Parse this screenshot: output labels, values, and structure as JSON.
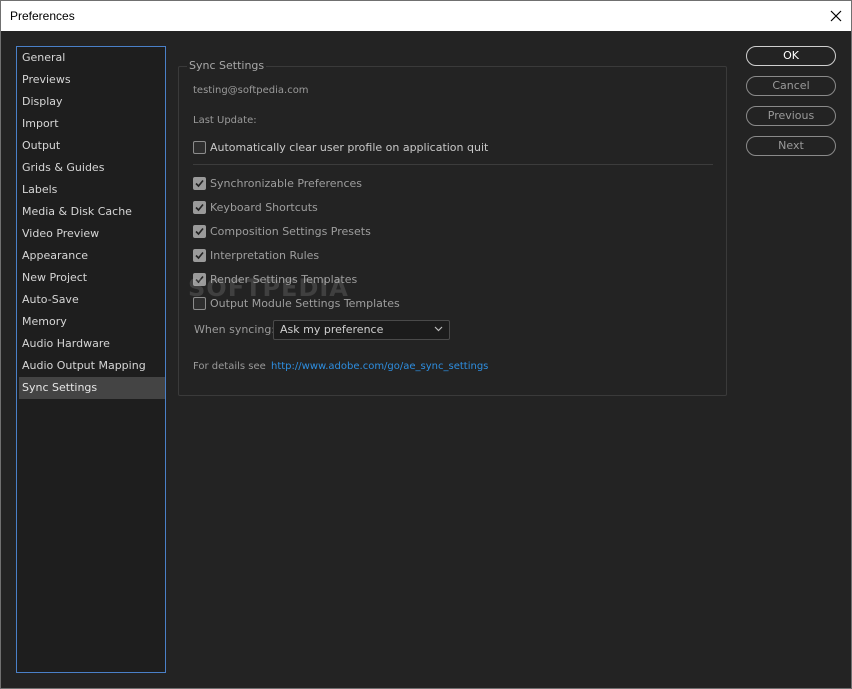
{
  "window": {
    "title": "Preferences"
  },
  "sidebar": {
    "items": [
      {
        "label": "General"
      },
      {
        "label": "Previews"
      },
      {
        "label": "Display"
      },
      {
        "label": "Import"
      },
      {
        "label": "Output"
      },
      {
        "label": "Grids & Guides"
      },
      {
        "label": "Labels"
      },
      {
        "label": "Media & Disk Cache"
      },
      {
        "label": "Video Preview"
      },
      {
        "label": "Appearance"
      },
      {
        "label": "New Project"
      },
      {
        "label": "Auto-Save"
      },
      {
        "label": "Memory"
      },
      {
        "label": "Audio Hardware"
      },
      {
        "label": "Audio Output Mapping"
      },
      {
        "label": "Sync Settings"
      }
    ],
    "selected": "Sync Settings"
  },
  "sync": {
    "section_title": "Sync Settings",
    "account": "testing@softpedia.com",
    "last_update_label": "Last Update:",
    "auto_clear": {
      "label": "Automatically clear user profile on application quit",
      "checked": false
    },
    "options": [
      {
        "label": "Synchronizable Preferences",
        "checked": true
      },
      {
        "label": "Keyboard Shortcuts",
        "checked": true
      },
      {
        "label": "Composition Settings Presets",
        "checked": true
      },
      {
        "label": "Interpretation Rules",
        "checked": true
      },
      {
        "label": "Render Settings Templates",
        "checked": true
      },
      {
        "label": "Output Module Settings Templates",
        "checked": false
      }
    ],
    "when_syncing_label": "When syncing:",
    "when_syncing_value": "Ask my preference",
    "details_label": "For details see",
    "details_link": "http://www.adobe.com/go/ae_sync_settings"
  },
  "buttons": {
    "ok": "OK",
    "cancel": "Cancel",
    "previous": "Previous",
    "next": "Next"
  },
  "watermark": "SOFTPEDIA",
  "colors": {
    "background": "#232323",
    "sidebar_border": "#4a80c8",
    "selected_item": "#444444",
    "link": "#2e8ee0"
  }
}
